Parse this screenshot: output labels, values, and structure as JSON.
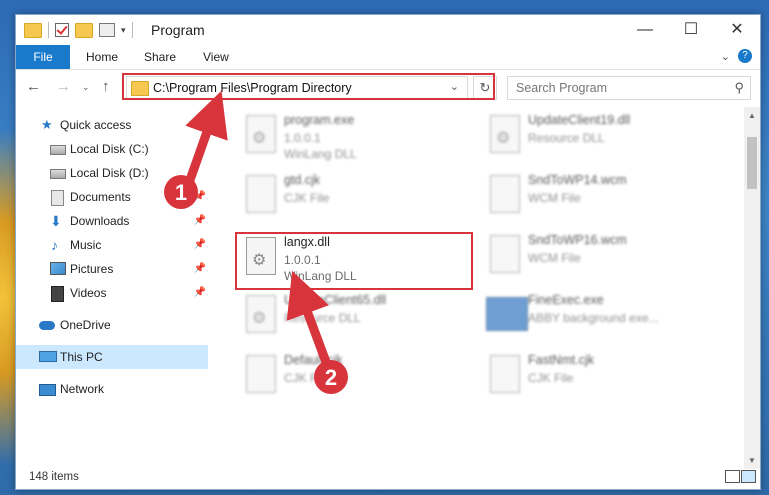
{
  "window": {
    "title": "Program",
    "minimize": "—",
    "maximize": "☐",
    "close": "✕"
  },
  "ribbon": {
    "tabs": [
      "File",
      "Home",
      "Share",
      "View"
    ],
    "help": "?"
  },
  "address": {
    "path": "C:\\Program Files\\Program Directory",
    "search_placeholder": "Search Program"
  },
  "sidebar": {
    "items": [
      {
        "label": "Quick access",
        "icon": "star-icon",
        "pinned": false
      },
      {
        "label": "Local Disk (C:)",
        "icon": "drive-icon",
        "pinned": false
      },
      {
        "label": "Local Disk (D:)",
        "icon": "drive-icon",
        "pinned": false
      },
      {
        "label": "Documents",
        "icon": "documents-icon",
        "pinned": true
      },
      {
        "label": "Downloads",
        "icon": "downloads-icon",
        "pinned": true
      },
      {
        "label": "Music",
        "icon": "music-icon",
        "pinned": true
      },
      {
        "label": "Pictures",
        "icon": "pictures-icon",
        "pinned": true
      },
      {
        "label": "Videos",
        "icon": "videos-icon",
        "pinned": true
      },
      {
        "label": "OneDrive",
        "icon": "onedrive-icon",
        "pinned": false
      },
      {
        "label": "This PC",
        "icon": "this-pc-icon",
        "pinned": false,
        "selected": true
      },
      {
        "label": "Network",
        "icon": "network-icon",
        "pinned": false
      }
    ]
  },
  "status": {
    "item_count": "148 items"
  },
  "files": [
    {
      "name": "program.exe",
      "line2": "1.0.0.1",
      "line3": "WinLang DLL",
      "blurred": true
    },
    {
      "name": "UpdateClient19.dll",
      "line2": "Resource DLL",
      "line3": "",
      "blurred": true
    },
    {
      "name": "gtd.cjk",
      "line2": "CJK File",
      "line3": "",
      "blurred": true
    },
    {
      "name": "SndToWP14.wcm",
      "line2": "WCM File",
      "line3": "",
      "blurred": true
    },
    {
      "name": "langx.dll",
      "line2": "1.0.0.1",
      "line3": "WinLang DLL",
      "blurred": false
    },
    {
      "name": "SndToWP16.wcm",
      "line2": "WCM File",
      "line3": "",
      "blurred": true
    },
    {
      "name": "UpdateClient65.dll",
      "line2": "Resource DLL",
      "line3": "",
      "blurred": true
    },
    {
      "name": "FineExec.exe",
      "line2": "ABBY background exe...",
      "line3": "",
      "blurred": true
    },
    {
      "name": "Default.cjk",
      "line2": "CJK File",
      "line3": "",
      "blurred": true
    },
    {
      "name": "FastNmt.cjk",
      "line2": "CJK File",
      "line3": "",
      "blurred": true
    }
  ],
  "annotations": {
    "step1": "1",
    "step2": "2"
  },
  "colors": {
    "accent": "#1979ca",
    "highlight": "#d8343c",
    "selected_bg": "#cce8ff"
  }
}
